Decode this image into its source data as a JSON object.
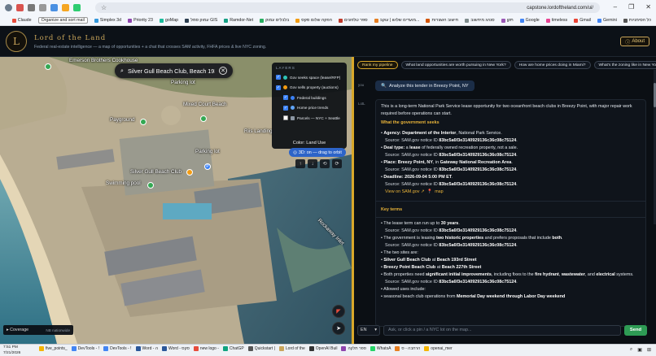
{
  "browser": {
    "url": "capstone.lordoftheland.com/ui/",
    "bookmarks": [
      "כל הסימניות",
      "Gemini",
      "Gmail",
      "timeless",
      "Google",
      "תקן",
      "סנהג מיחשוב",
      "חישוב השצרות",
      "מועדים שלוש | עוקב...",
      "ספר טלפונים",
      "הפקה שלום סקס",
      "בלבלים עמוק",
      "Ramdor-Net",
      "עמוק סמל GIS",
      "goMap",
      "Priority 23",
      "Simplex 3d",
      "Organize and sort mail",
      "Claude"
    ],
    "window_controls": [
      "–",
      "❐",
      "✕"
    ]
  },
  "header": {
    "logo_initial": "L",
    "brand": "Lord of the Land",
    "tagline": "Federal real-estate intelligence — a map of opportunities + a chat that crosses SAM activity, FHFA prices & live NYC zoning.",
    "about_label": "About",
    "about_icon": "info-icon"
  },
  "map": {
    "search_value": "Silver Gull Beach Club, Beach 193",
    "search_icon": "search-icon",
    "labels": [
      "Emerson Brothers Cookhouse",
      "Parking lot",
      "Mixed Court Beach",
      "Riis Landing",
      "Payground",
      "Parking lot",
      "Silver Gull Beach Club",
      "Swimming pool",
      "Rockaway Inlet"
    ],
    "layers": {
      "title": "LAYERS",
      "items": [
        {
          "label": "Gov seeks space (lease/RFP)",
          "checked": true,
          "color": "#2ec4b6"
        },
        {
          "label": "Gov sells property (auctions)",
          "checked": true,
          "color": "#f39c12"
        },
        {
          "label": "Federal buildings",
          "checked": true,
          "color": "#3b82f6"
        },
        {
          "label": "Home price trends",
          "checked": true,
          "color": "#60a5fa"
        },
        {
          "label": "Parcels — NYC + Seattle",
          "checked": false,
          "color": "#8b96a3"
        }
      ],
      "color_mode": "Color: Land Use"
    },
    "orbit_label": "3D: on — drag to orbit",
    "controls": [
      "↑",
      "↓",
      "⟲",
      "⟳"
    ],
    "coverage_label": "Coverage",
    "coverage_count": "NB nationwide"
  },
  "panel": {
    "chips": [
      "Rank my pipeline",
      "What land opportunities are worth pursuing in New York?",
      "How are home prices doing in Miami?",
      "What's the zoning like in New York?"
    ],
    "user_role": "you",
    "user_message": "Analyze this tender in Breezy Point, NY",
    "bot_role": "LotL",
    "intro": "This is a long-term National Park Service lease opportunity for two oceanfront beach clubs in Breezy Point, with major repair work required before operations can start.",
    "section1": "What the government seeks",
    "agency_label": "Agency:",
    "agency_value": "Department of the Interior",
    "agency_rest": ", National Park Service.",
    "deal_label": "Deal type:",
    "deal_pre": " a ",
    "deal_bold": "lease",
    "deal_rest": " of federally owned recreation property, not a sale.",
    "place_label": "Place:",
    "place_value": "Breezy Point, NY",
    "place_mid": ", in ",
    "place_bold": "Gateway National Recreation Area",
    "place_end": ".",
    "deadline_label": "Deadline:",
    "deadline_value": "2026-09-04 5:00 PM ET",
    "deadline_end": ".",
    "source_prefix": "Source: SAM.gov notice ID ",
    "notice_id": "83bc5a6f3e3140929136c36c08c75124",
    "source_end": ".",
    "link_label": "View on SAM.gov ↗",
    "map_label": "map",
    "section2": "Key terms",
    "term1_pre": "The lease term can run up to ",
    "term1_bold": "30 years",
    "term1_end": ".",
    "term2_pre": "The government is leasing ",
    "term2_bold1": "two historic properties",
    "term2_mid": " and prefers proposals that include ",
    "term2_bold2": "both",
    "term2_end": ".",
    "term3": "The two sites are:",
    "site1_bold": "Silver Gull Beach Club",
    "site1_mid": " at ",
    "site1_bold2": "Beach 193rd Street",
    "site2_bold": "Breezy Point Beach Club",
    "site2_mid": " at ",
    "site2_bold2": "Beach 227th Street",
    "term4_pre": "Both properties need ",
    "term4_bold1": "significant initial improvements",
    "term4_mid": ", including fixes to the ",
    "term4_bold2": "fire hydrant",
    "term4_mid2": ", ",
    "term4_bold3": "wastewater",
    "term4_mid3": ", and ",
    "term4_bold4": "electrical",
    "term4_end": " systems.",
    "term5": "Allowed uses include:",
    "term6_pre": "seasonal beach club operations from ",
    "term6_bold": "Memorial Day weekend through Labor Day weekend",
    "lang": "EN",
    "input_placeholder": "Ask, or click a pin / a NYC lot on the map...",
    "send_label": "Send"
  },
  "taskbar": {
    "time": "7:51 PM",
    "date": "7/21/2026",
    "items": [
      "five_points_",
      "DevTools - !",
      "DevTools - !",
      "Word - ה",
      "Word - סקס",
      "new logo -",
      "ChatGP",
      "Quickstart |",
      "Lord of the",
      "OpenAI Buil",
      "ספר תלקה",
      "WhatsA",
      "הרחבה - ס",
      "openai_mer"
    ]
  }
}
